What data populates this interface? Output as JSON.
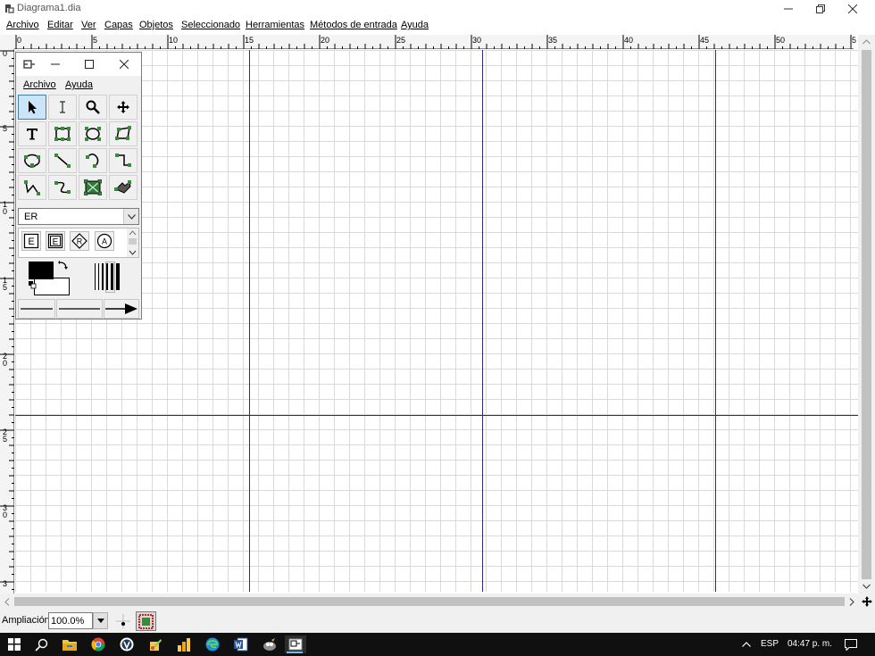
{
  "window": {
    "title": "Diagrama1.dia",
    "minimize_icon": "minimize-icon",
    "restore_icon": "restore-icon",
    "close_icon": "close-icon"
  },
  "menubar": {
    "items": [
      {
        "label": "Archivo"
      },
      {
        "label": "Editar"
      },
      {
        "label": "Ver"
      },
      {
        "label": "Capas"
      },
      {
        "label": "Objetos"
      },
      {
        "label": "Seleccionado"
      },
      {
        "label": "Herramientas"
      },
      {
        "label": "Métodos de entrada"
      },
      {
        "label": "Ayuda"
      }
    ]
  },
  "hruler": {
    "labels": [
      "0",
      "5",
      "10",
      "15",
      "20",
      "25",
      "30",
      "35",
      "40",
      "45",
      "50",
      "5"
    ]
  },
  "vruler": {
    "labels": [
      "0",
      "5",
      "1\n0",
      "1\n5",
      "2\n0",
      "2\n5",
      "3\n0",
      "3"
    ]
  },
  "toolbox": {
    "menu": [
      {
        "label": "Archivo"
      },
      {
        "label": "Ayuda"
      }
    ],
    "tools": [
      {
        "name": "pointer-icon"
      },
      {
        "name": "text-edit-icon"
      },
      {
        "name": "magnify-icon"
      },
      {
        "name": "scroll-icon"
      },
      {
        "name": "text-icon"
      },
      {
        "name": "box-icon"
      },
      {
        "name": "ellipse-icon"
      },
      {
        "name": "polygon-icon"
      },
      {
        "name": "beziergon-icon"
      },
      {
        "name": "line-icon"
      },
      {
        "name": "arc-icon"
      },
      {
        "name": "zigzag-line-icon"
      },
      {
        "name": "polyline-icon"
      },
      {
        "name": "bezier-line-icon"
      },
      {
        "name": "image-icon"
      },
      {
        "name": "outline-icon"
      }
    ],
    "sheet": {
      "selected": "ER"
    },
    "er_objects": [
      {
        "name": "entity-icon",
        "glyph": "E"
      },
      {
        "name": "weak-entity-icon",
        "glyph": "E"
      },
      {
        "name": "relationship-icon",
        "glyph": "R"
      },
      {
        "name": "attribute-icon",
        "glyph": "A"
      }
    ],
    "colors": {
      "foreground": "#000000",
      "background": "#ffffff"
    }
  },
  "statusbar": {
    "zoom_label": "Ampliación",
    "zoom_value": "100.0%"
  },
  "taskbar": {
    "language": "ESP",
    "time": "04:47 p. m."
  }
}
